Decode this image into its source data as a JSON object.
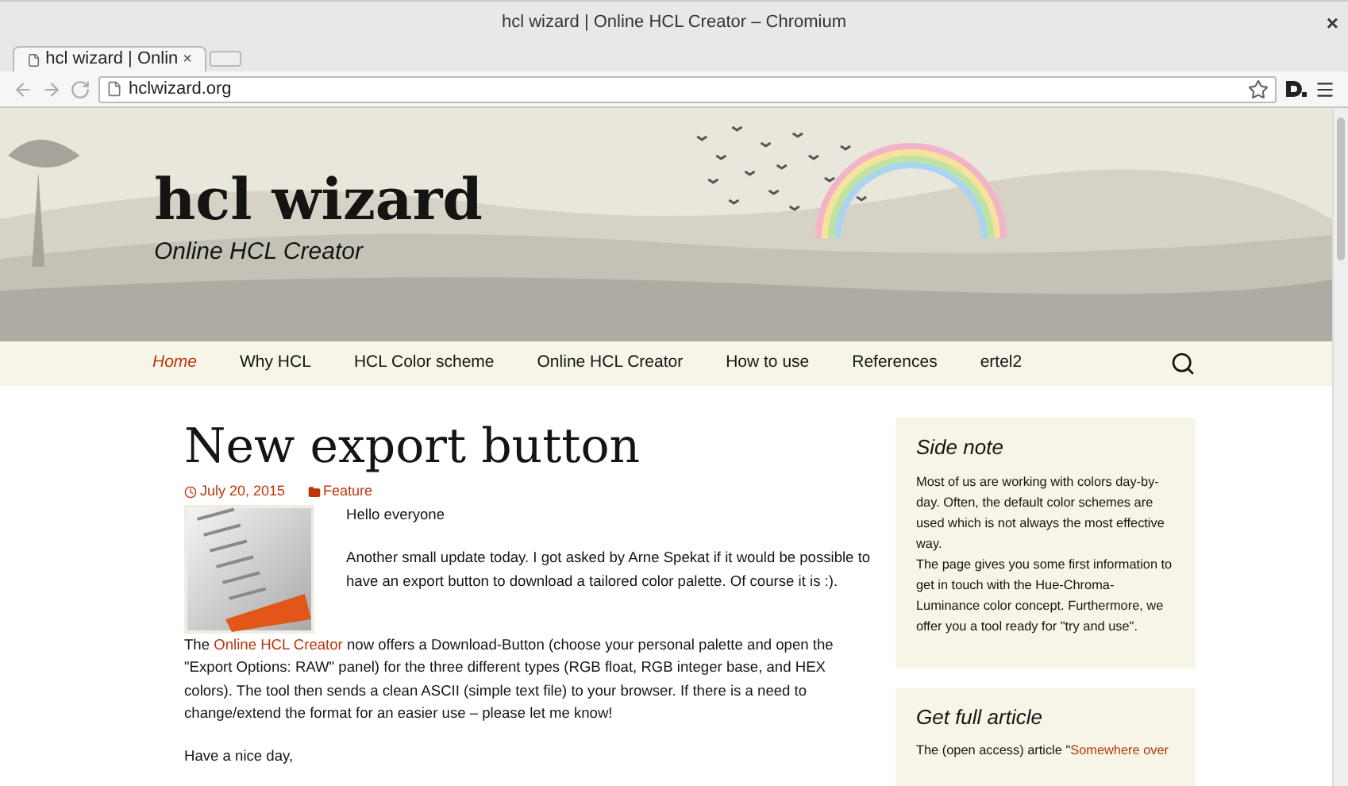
{
  "window": {
    "title": "hcl wizard | Online HCL Creator – Chromium",
    "close": "×"
  },
  "tabs": [
    {
      "label": "hcl wizard | Onlin",
      "close": "×",
      "selected": true
    }
  ],
  "address_bar": {
    "value": "hclwizard.org"
  },
  "site": {
    "title": "hcl wizard",
    "tagline": "Online HCL Creator"
  },
  "nav": [
    {
      "label": "Home",
      "selected": true
    },
    {
      "label": "Why HCL",
      "selected": false
    },
    {
      "label": "HCL Color scheme",
      "selected": false
    },
    {
      "label": "Online HCL Creator",
      "selected": false
    },
    {
      "label": "How to use",
      "selected": false
    },
    {
      "label": "References",
      "selected": false
    },
    {
      "label": "ertel2",
      "selected": false
    }
  ],
  "post": {
    "title": "New export button",
    "date": "July 20, 2015",
    "category": "Feature",
    "paragraphs": [
      {
        "parts": [
          {
            "text": "Hello everyone"
          }
        ]
      },
      {
        "parts": [
          {
            "text": "Another small update today. I got asked by Arne Spekat if it would be possible to have an export button to download a tailored color palette. Of course it is :)."
          }
        ]
      },
      {
        "parts": [
          {
            "text": "The "
          },
          {
            "text": "Online HCL Creator",
            "link": true
          },
          {
            "text": " now offers a Download-Button (choose your personal palette and open the \"Export Options: RAW\" panel) for the three different types (RGB float, RGB integer base, and HEX colors). The tool then sends a clean ASCII (simple text file) to your browser. If there is a need to change/extend the format for an easier use – please let me know!"
          }
        ]
      },
      {
        "parts": [
          {
            "text": "Have a nice day,"
          }
        ]
      }
    ]
  },
  "sidebar": [
    {
      "title": "Side note",
      "paragraphs": [
        {
          "parts": [
            {
              "text": "Most of us are working with colors day-by-day. Often, the default color schemes are used which is not always the most effective way."
            }
          ]
        },
        {
          "parts": [
            {
              "text": "The page gives you some first information to get in touch with the Hue-Chroma-Luminance color concept. Furthermore, we offer you a tool ready for \"try and use\"."
            }
          ]
        }
      ]
    },
    {
      "title": "Get full article",
      "paragraphs": [
        {
          "parts": [
            {
              "text": "The (open access) article \""
            },
            {
              "text": "Somewhere over",
              "link": true
            }
          ]
        }
      ]
    }
  ]
}
